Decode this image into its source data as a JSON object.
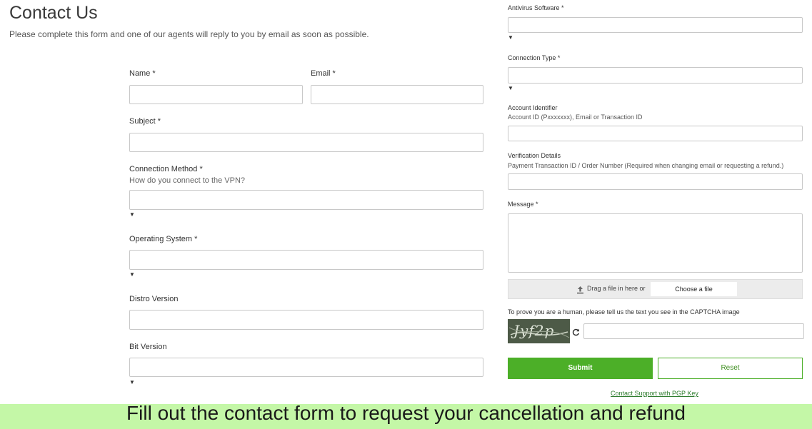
{
  "page": {
    "title": "Contact Us",
    "subtitle": "Please complete this form and one of our agents will reply to you by email as soon as possible."
  },
  "left_form": {
    "name_label": "Name *",
    "email_label": "Email *",
    "subject_label": "Subject *",
    "connection_method_label": "Connection Method *",
    "connection_method_hint": "How do you connect to the VPN?",
    "os_label": "Operating System *",
    "distro_label": "Distro Version",
    "bit_label": "Bit Version"
  },
  "right_form": {
    "antivirus_label": "Antivirus Software *",
    "connection_type_label": "Connection Type *",
    "account_label": "Account Identifier",
    "account_hint": "Account ID (Pxxxxxxx), Email or Transaction ID",
    "verification_label": "Verification Details",
    "verification_hint": "Payment Transaction ID / Order Number (Required when changing email or requesting a refund.)",
    "message_label": "Message *"
  },
  "upload": {
    "drag_text": "Drag a file in here or",
    "choose_label": "Choose a file"
  },
  "captcha": {
    "prompt": "To prove you are a human, please tell us the text you see in the CAPTCHA image",
    "image_text": "Jyf2p"
  },
  "buttons": {
    "submit": "Submit",
    "reset": "Reset",
    "pgp_link": "Contact Support with PGP Key"
  },
  "banner": {
    "text": "Fill out the contact form to request your cancellation and refund",
    "background": "#c4f7a7"
  },
  "colors": {
    "accent": "#4caf28"
  },
  "icons": {
    "dropdown": "caret-down-icon",
    "upload": "upload-icon",
    "refresh": "refresh-icon"
  }
}
